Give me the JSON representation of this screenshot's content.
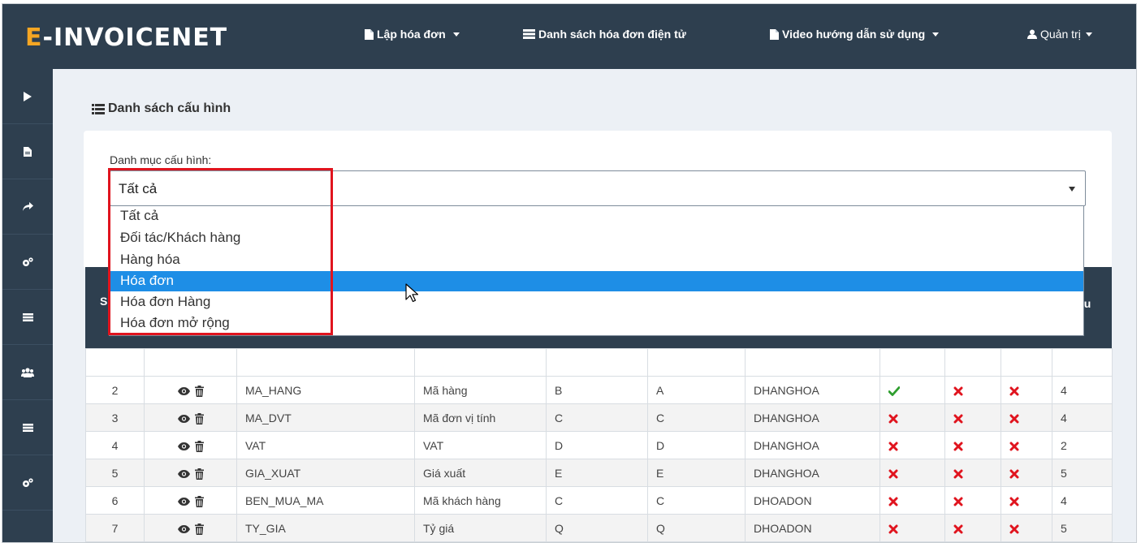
{
  "brand": {
    "logo_e": "E",
    "logo_rest": "-INVOICENET"
  },
  "nav": {
    "create_invoice": "Lập hóa đơn",
    "invoice_list": "Danh sách hóa đơn điện tử",
    "video_guide": "Video hướng dẫn sử dụng",
    "admin": "Quản trị"
  },
  "sidebar": {
    "icons": [
      "play-icon",
      "file-icon",
      "share-icon",
      "cogs-icon",
      "list-icon",
      "users-icon",
      "list-icon",
      "cogs-icon"
    ]
  },
  "page": {
    "title": "Danh sách cấu hình"
  },
  "filter": {
    "label": "Danh mục cấu hình:",
    "selected": "Tất cả",
    "options": [
      "Tất cả",
      "Đối tác/Khách hàng",
      "Hàng hóa",
      "Hóa đơn",
      "Hóa đơn Hàng",
      "Hóa đơn mở rộng"
    ],
    "highlighted_index": 3
  },
  "table": {
    "header_partial": {
      "stt": "S",
      "last": "ệu"
    },
    "rows": [
      {
        "stt": "2",
        "code": "MA_HANG",
        "name": "Mã hàng",
        "col_a": "B",
        "col_b": "A",
        "table": "DHANGHOA",
        "f1": "check",
        "f2": "x",
        "f3": "x",
        "num": "4"
      },
      {
        "stt": "3",
        "code": "MA_DVT",
        "name": "Mã đơn vị tính",
        "col_a": "C",
        "col_b": "C",
        "table": "DHANGHOA",
        "f1": "x",
        "f2": "x",
        "f3": "x",
        "num": "4"
      },
      {
        "stt": "4",
        "code": "VAT",
        "name": "VAT",
        "col_a": "D",
        "col_b": "D",
        "table": "DHANGHOA",
        "f1": "x",
        "f2": "x",
        "f3": "x",
        "num": "2"
      },
      {
        "stt": "5",
        "code": "GIA_XUAT",
        "name": "Giá xuất",
        "col_a": "E",
        "col_b": "E",
        "table": "DHANGHOA",
        "f1": "x",
        "f2": "x",
        "f3": "x",
        "num": "5"
      },
      {
        "stt": "6",
        "code": "BEN_MUA_MA",
        "name": "Mã khách hàng",
        "col_a": "C",
        "col_b": "C",
        "table": "DHOADON",
        "f1": "x",
        "f2": "x",
        "f3": "x",
        "num": "4"
      },
      {
        "stt": "7",
        "code": "TY_GIA",
        "name": "Tỷ giá",
        "col_a": "Q",
        "col_b": "Q",
        "table": "DHOADON",
        "f1": "x",
        "f2": "x",
        "f3": "x",
        "num": "5"
      }
    ]
  },
  "colors": {
    "nav_bg": "#2e3f4f",
    "logo_accent": "#f5a623",
    "highlight": "#1e8ee6",
    "check": "#2e9e2e",
    "cross": "#e0141e",
    "annotation": "#e0141e"
  }
}
